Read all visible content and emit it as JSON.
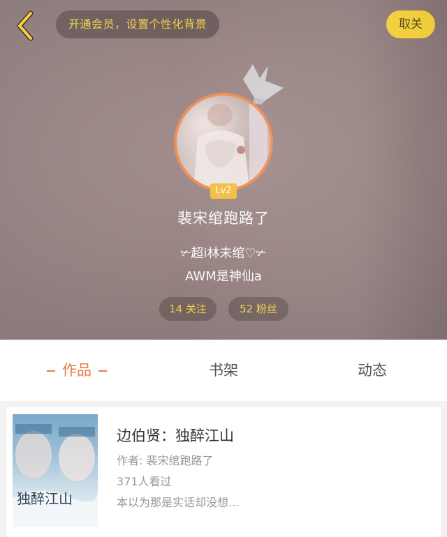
{
  "header": {
    "vip_prompt": "开通会员，设置个性化背景",
    "unfollow_label": "取关",
    "level": "Lv2",
    "username": "裴宋绾跑路了",
    "bio_line1": "✃超i林未绾♡✃",
    "bio_line2": "AWM是神仙a",
    "following": "14 关注",
    "fans": "52 粉丝",
    "colors": {
      "accent_yellow": "#f7d23a",
      "avatar_ring": "#f2925c"
    }
  },
  "tabs": {
    "works": "作品",
    "shelf": "书架",
    "feed": "动态",
    "active_color": "#e8794a"
  },
  "book": {
    "title": "边伯贤：独醉江山",
    "author": "作者: 裴宋绾跑路了",
    "views": "371人看过",
    "desc": "本以为那是实话却没想…",
    "cover_text": "独醉江山"
  },
  "icons": {
    "back": "chevron-left-icon",
    "crown": "crown-icon"
  }
}
